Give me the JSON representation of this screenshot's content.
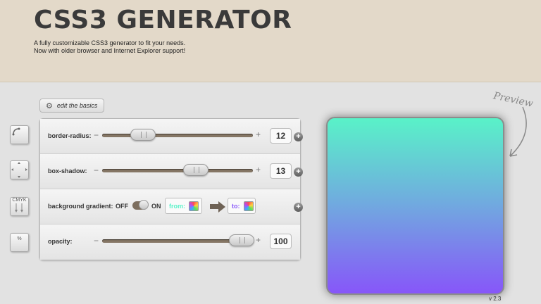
{
  "header": {
    "title": "CSS3 GENERATOR",
    "tagline_line1": "A fully customizable CSS3 generator to fit your needs.",
    "tagline_line2": "Now with older browser and Internet Explorer support!"
  },
  "toolbar": {
    "edit_basics_label": "edit the basics"
  },
  "sidebar": {
    "icons": [
      {
        "name": "border-radius-icon",
        "text": ""
      },
      {
        "name": "box-shadow-icon",
        "text": ""
      },
      {
        "name": "cmyk-gradient-icon",
        "text": "CMYK"
      },
      {
        "name": "opacity-icon",
        "text": "%"
      }
    ]
  },
  "controls": {
    "border_radius": {
      "label": "border-radius:",
      "value": "12",
      "slider_fraction": 0.26
    },
    "box_shadow": {
      "label": "box-shadow:",
      "value": "13",
      "slider_fraction": 0.63
    },
    "gradient": {
      "label": "background gradient:",
      "off_label": "OFF",
      "on_label": "ON",
      "from_label": "from:",
      "to_label": "to:",
      "from_color": "#59f2c8",
      "to_color": "#8756f9"
    },
    "opacity": {
      "label": "opacity:",
      "value": "100",
      "slider_fraction": 0.93
    },
    "minus_glyph": "−",
    "plus_glyph": "+"
  },
  "preview": {
    "label": "Preview",
    "gradient_top": "#59f2c8",
    "gradient_bottom": "#8756f9"
  },
  "footer": {
    "version": "v 2.3"
  }
}
